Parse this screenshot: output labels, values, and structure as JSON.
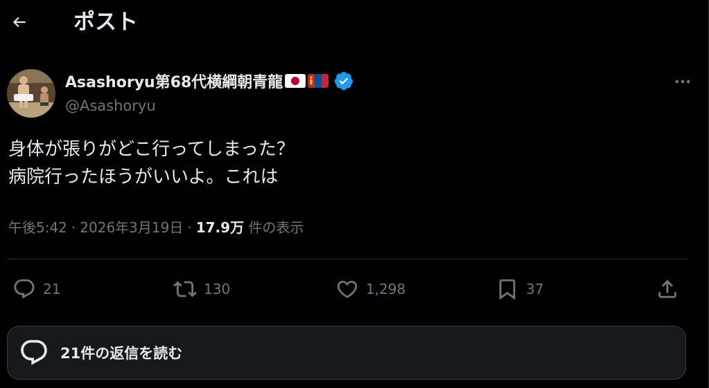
{
  "header": {
    "title": "ポスト",
    "back_icon": "arrow-left-icon"
  },
  "author": {
    "display_name": "Asashoryu第68代横綱朝青龍",
    "handle": "@Asashoryu",
    "flags": [
      "japan-flag-icon",
      "mongolia-flag-icon"
    ],
    "verified_icon": "verified-badge-icon",
    "verified_color": "#1d9bf0"
  },
  "tweet": {
    "lines": [
      "身体が張りがどこ行ってしまった？",
      "病院行ったほうがいいよ。これは"
    ]
  },
  "meta": {
    "time": "午後5:42",
    "separator": "·",
    "date": "2026年3月19日",
    "views_count": "17.9万",
    "views_label": "件の表示"
  },
  "actions": {
    "reply": {
      "icon": "reply-icon",
      "count": "21"
    },
    "repost": {
      "icon": "repost-icon",
      "count": "130"
    },
    "like": {
      "icon": "heart-icon",
      "count": "1,298"
    },
    "bookmark": {
      "icon": "bookmark-icon",
      "count": "37"
    },
    "share": {
      "icon": "share-icon"
    }
  },
  "replies_button": {
    "label": "21件の返信を読む",
    "icon": "speech-bubble-icon"
  },
  "colors": {
    "background": "#000000",
    "text_primary": "#e7e9ea",
    "text_secondary": "#71767b",
    "border": "#2f3336",
    "accent": "#1d9bf0"
  }
}
